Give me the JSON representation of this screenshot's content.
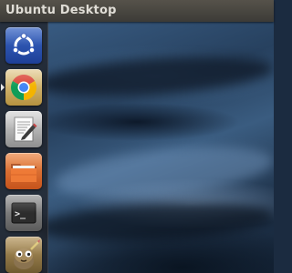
{
  "top_panel": {
    "title": "Ubuntu Desktop"
  },
  "launcher": {
    "items": [
      {
        "icon": "ubuntu-dash-icon",
        "running": false
      },
      {
        "icon": "chrome-icon",
        "running": true
      },
      {
        "icon": "text-editor-icon",
        "running": false
      },
      {
        "icon": "files-folder-icon",
        "running": false
      },
      {
        "icon": "terminal-icon",
        "running": false
      },
      {
        "icon": "gimp-icon",
        "running": false
      }
    ]
  },
  "terminal_glyph": ">_"
}
